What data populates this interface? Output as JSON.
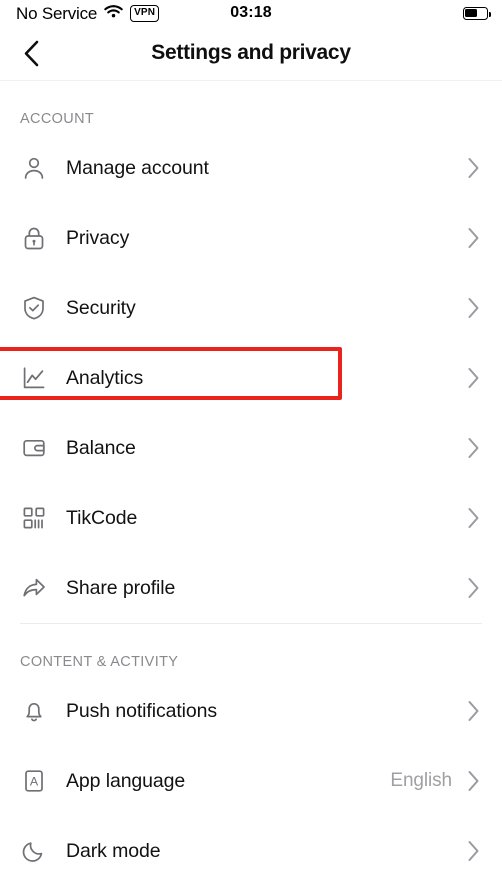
{
  "statusbar": {
    "carrier": "No Service",
    "wifi_icon": "wifi-icon",
    "vpn_badge": "VPN",
    "time": "03:18",
    "battery_icon": "battery-icon",
    "battery_level_pct": 55
  },
  "navbar": {
    "back_icon": "chevron-left-icon",
    "title": "Settings and privacy"
  },
  "sections": [
    {
      "header": "ACCOUNT",
      "items": [
        {
          "label": "Manage account",
          "icon": "person-icon",
          "value": "",
          "chevron": "chevron-right-icon",
          "highlighted": false
        },
        {
          "label": "Privacy",
          "icon": "lock-icon",
          "value": "",
          "chevron": "chevron-right-icon",
          "highlighted": false
        },
        {
          "label": "Security",
          "icon": "shield-check-icon",
          "value": "",
          "chevron": "chevron-right-icon",
          "highlighted": false
        },
        {
          "label": "Analytics",
          "icon": "chart-line-icon",
          "value": "",
          "chevron": "chevron-right-icon",
          "highlighted": true
        },
        {
          "label": "Balance",
          "icon": "wallet-icon",
          "value": "",
          "chevron": "chevron-right-icon",
          "highlighted": false
        },
        {
          "label": "TikCode",
          "icon": "qr-code-icon",
          "value": "",
          "chevron": "chevron-right-icon",
          "highlighted": false
        },
        {
          "label": "Share profile",
          "icon": "share-arrow-icon",
          "value": "",
          "chevron": "chevron-right-icon",
          "highlighted": false
        }
      ]
    },
    {
      "header": "CONTENT & ACTIVITY",
      "items": [
        {
          "label": "Push notifications",
          "icon": "bell-icon",
          "value": "",
          "chevron": "chevron-right-icon",
          "highlighted": false
        },
        {
          "label": "App language",
          "icon": "letter-a-icon",
          "value": "English",
          "chevron": "chevron-right-icon",
          "highlighted": false
        },
        {
          "label": "Dark mode",
          "icon": "moon-icon",
          "value": "",
          "chevron": "chevron-right-icon",
          "highlighted": false
        }
      ]
    }
  ],
  "colors": {
    "highlight": "#e8241c",
    "icon": "#6f6f74",
    "chevron": "#9a9aa0",
    "text": "#121212",
    "section_header": "#8a8a8e",
    "value_text": "#a0a0a4",
    "divider": "#ececec",
    "background": "#ffffff"
  }
}
